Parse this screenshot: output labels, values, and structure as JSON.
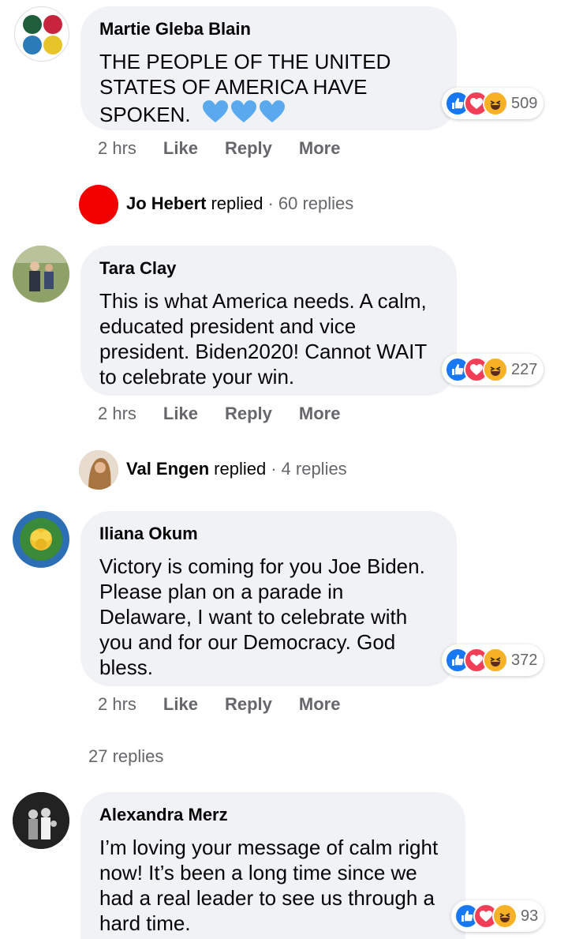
{
  "comments": [
    {
      "author": "Martie Gleba Blain",
      "text": "THE PEOPLE OF THE UNITED STATES OF AMERICA HAVE SPOKEN.",
      "reaction_count": "509",
      "time": "2 hrs",
      "actions": {
        "like": "Like",
        "reply": "Reply",
        "more": "More"
      },
      "reply_summary": {
        "name": "Jo Hebert",
        "verb": "replied",
        "count": "60 replies"
      }
    },
    {
      "author": "Tara Clay",
      "text": "This is what America needs. A calm, educated president and vice president. Biden2020! Cannot WAIT to celebrate your win.",
      "reaction_count": "227",
      "time": "2 hrs",
      "actions": {
        "like": "Like",
        "reply": "Reply",
        "more": "More"
      },
      "reply_summary": {
        "name": "Val Engen",
        "verb": "replied",
        "count": "4 replies"
      }
    },
    {
      "author": "Iliana Okum",
      "text": "Victory is coming for you Joe Biden. Please plan on a parade in Delaware, I want to celebrate with you and for our Democracy. God bless.",
      "reaction_count": "372",
      "time": "2 hrs",
      "actions": {
        "like": "Like",
        "reply": "Reply",
        "more": "More"
      },
      "replies_link": "27 replies"
    },
    {
      "author": "Alexandra Merz",
      "text": "I’m loving your message of calm right now! It’s been a long time since we had a real leader to see us through a hard time.",
      "reaction_count": "93"
    }
  ],
  "colors": {
    "like_blue": "#1877f2",
    "love_red": "#f33e58",
    "haha_yellow": "#f7b125",
    "heart_blue": "#5aa9ee",
    "bubble_gray": "#f0f2f5",
    "meta_gray": "#65676b"
  }
}
